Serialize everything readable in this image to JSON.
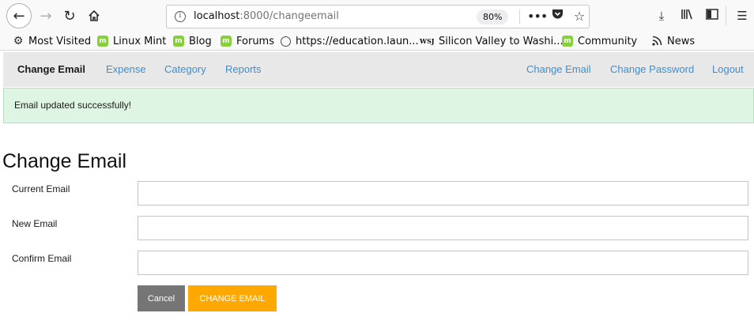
{
  "browser": {
    "url_host": "localhost",
    "url_rest": ":8000/changeemail",
    "zoom": "80%"
  },
  "bookmarks": [
    {
      "label": "Most Visited",
      "icon": "gear-icon"
    },
    {
      "label": "Linux Mint",
      "icon": "mint-icon"
    },
    {
      "label": "Blog",
      "icon": "mint-icon"
    },
    {
      "label": "Forums",
      "icon": "mint-icon"
    },
    {
      "label": "https://education.laun...",
      "icon": "globe-icon"
    },
    {
      "label": "Silicon Valley to Washi...",
      "icon": "wsj-icon"
    },
    {
      "label": "Community",
      "icon": "mint-icon"
    },
    {
      "label": "News",
      "icon": "rss-icon"
    }
  ],
  "nav": {
    "brand": "Change Email",
    "left_links": [
      "Expense",
      "Category",
      "Reports"
    ],
    "right_links": [
      "Change Email",
      "Change Password",
      "Logout"
    ]
  },
  "alert": {
    "message": "Email updated successfully!"
  },
  "form": {
    "title": "Change Email",
    "fields": [
      {
        "label": "Current Email",
        "value": ""
      },
      {
        "label": "New Email",
        "value": ""
      },
      {
        "label": "Confirm Email",
        "value": ""
      }
    ],
    "cancel_label": "Cancel",
    "submit_label": "CHANGE EMAIL"
  },
  "colors": {
    "link": "#3d8fd1",
    "alert_bg": "#dff5e3",
    "cancel_bg": "#757575",
    "submit_bg": "#ffa800"
  }
}
